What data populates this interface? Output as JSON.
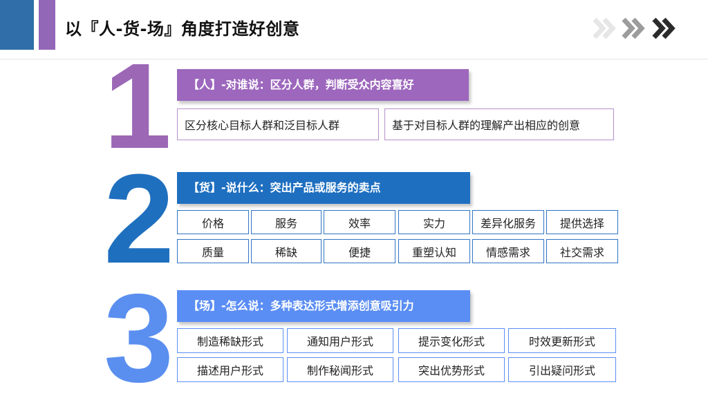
{
  "header": {
    "title": "以『人-货-场』角度打造好创意",
    "chevron_icons": [
      "chevron-double-right-icon",
      "chevron-double-right-icon",
      "chevron-double-right-icon"
    ],
    "accent_colors": {
      "blue": "#2f6ea8",
      "purple": "#9367b8"
    }
  },
  "sections": [
    {
      "number": "1",
      "color": "#9c68b6",
      "banner": "【人】-对谁说：区分人群，判断受众内容喜好",
      "items": [
        "区分核心目标人群和泛目标人群",
        "基于对目标人群的理解产出相应的创意"
      ]
    },
    {
      "number": "2",
      "color": "#1f6fbf",
      "banner": "【货】-说什么：突出产品或服务的卖点",
      "items": [
        "价格",
        "服务",
        "效率",
        "实力",
        "差异化服务",
        "提供选择",
        "质量",
        "稀缺",
        "便捷",
        "重塑认知",
        "情感需求",
        "社交需求"
      ]
    },
    {
      "number": "3",
      "color": "#5a8ff0",
      "banner": "【场】-怎么说：多种表达形式增添创意吸引力",
      "items": [
        "制造稀缺形式",
        "通知用户形式",
        "提示变化形式",
        "时效更新形式",
        "描述用户形式",
        "制作秘闻形式",
        "突出优势形式",
        "引出疑问形式"
      ]
    }
  ]
}
